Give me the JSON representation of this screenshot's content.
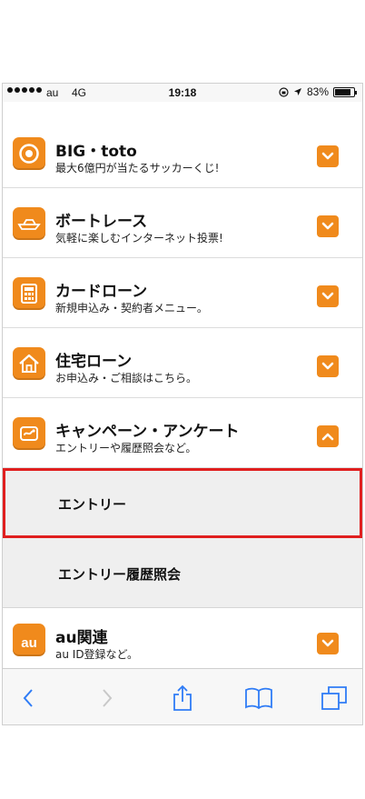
{
  "status_bar": {
    "carrier": "au",
    "network": "4G",
    "time": "19:18",
    "battery": "83%",
    "battery_level": 0.83
  },
  "menu": {
    "items": [
      {
        "title": "BIG・toto",
        "subtitle": "最大6億円が当たるサッカーくじ!",
        "icon": "target-icon",
        "expanded": false
      },
      {
        "title": "ボートレース",
        "subtitle": "気軽に楽しむインターネット投票!",
        "icon": "boat-icon",
        "expanded": false
      },
      {
        "title": "カードローン",
        "subtitle": "新規申込み・契約者メニュー。",
        "icon": "calculator-icon",
        "expanded": false
      },
      {
        "title": "住宅ローン",
        "subtitle": "お申込み・ご相談はこちら。",
        "icon": "house-icon",
        "expanded": false
      },
      {
        "title": "キャンペーン・アンケート",
        "subtitle": "エントリーや履歴照会など。",
        "icon": "campaign-icon",
        "expanded": true
      }
    ],
    "sub_items": [
      {
        "label": "エントリー"
      },
      {
        "label": "エントリー履歴照会"
      }
    ],
    "last_item": {
      "title": "au関連",
      "subtitle": "au ID登録など。",
      "icon_text": "au"
    }
  },
  "colors": {
    "accent": "#f08a1c",
    "highlight_border": "#e01f1f",
    "toolbar_icon": "#2f7cf6",
    "toolbar_icon_disabled": "#c8c8c8"
  }
}
